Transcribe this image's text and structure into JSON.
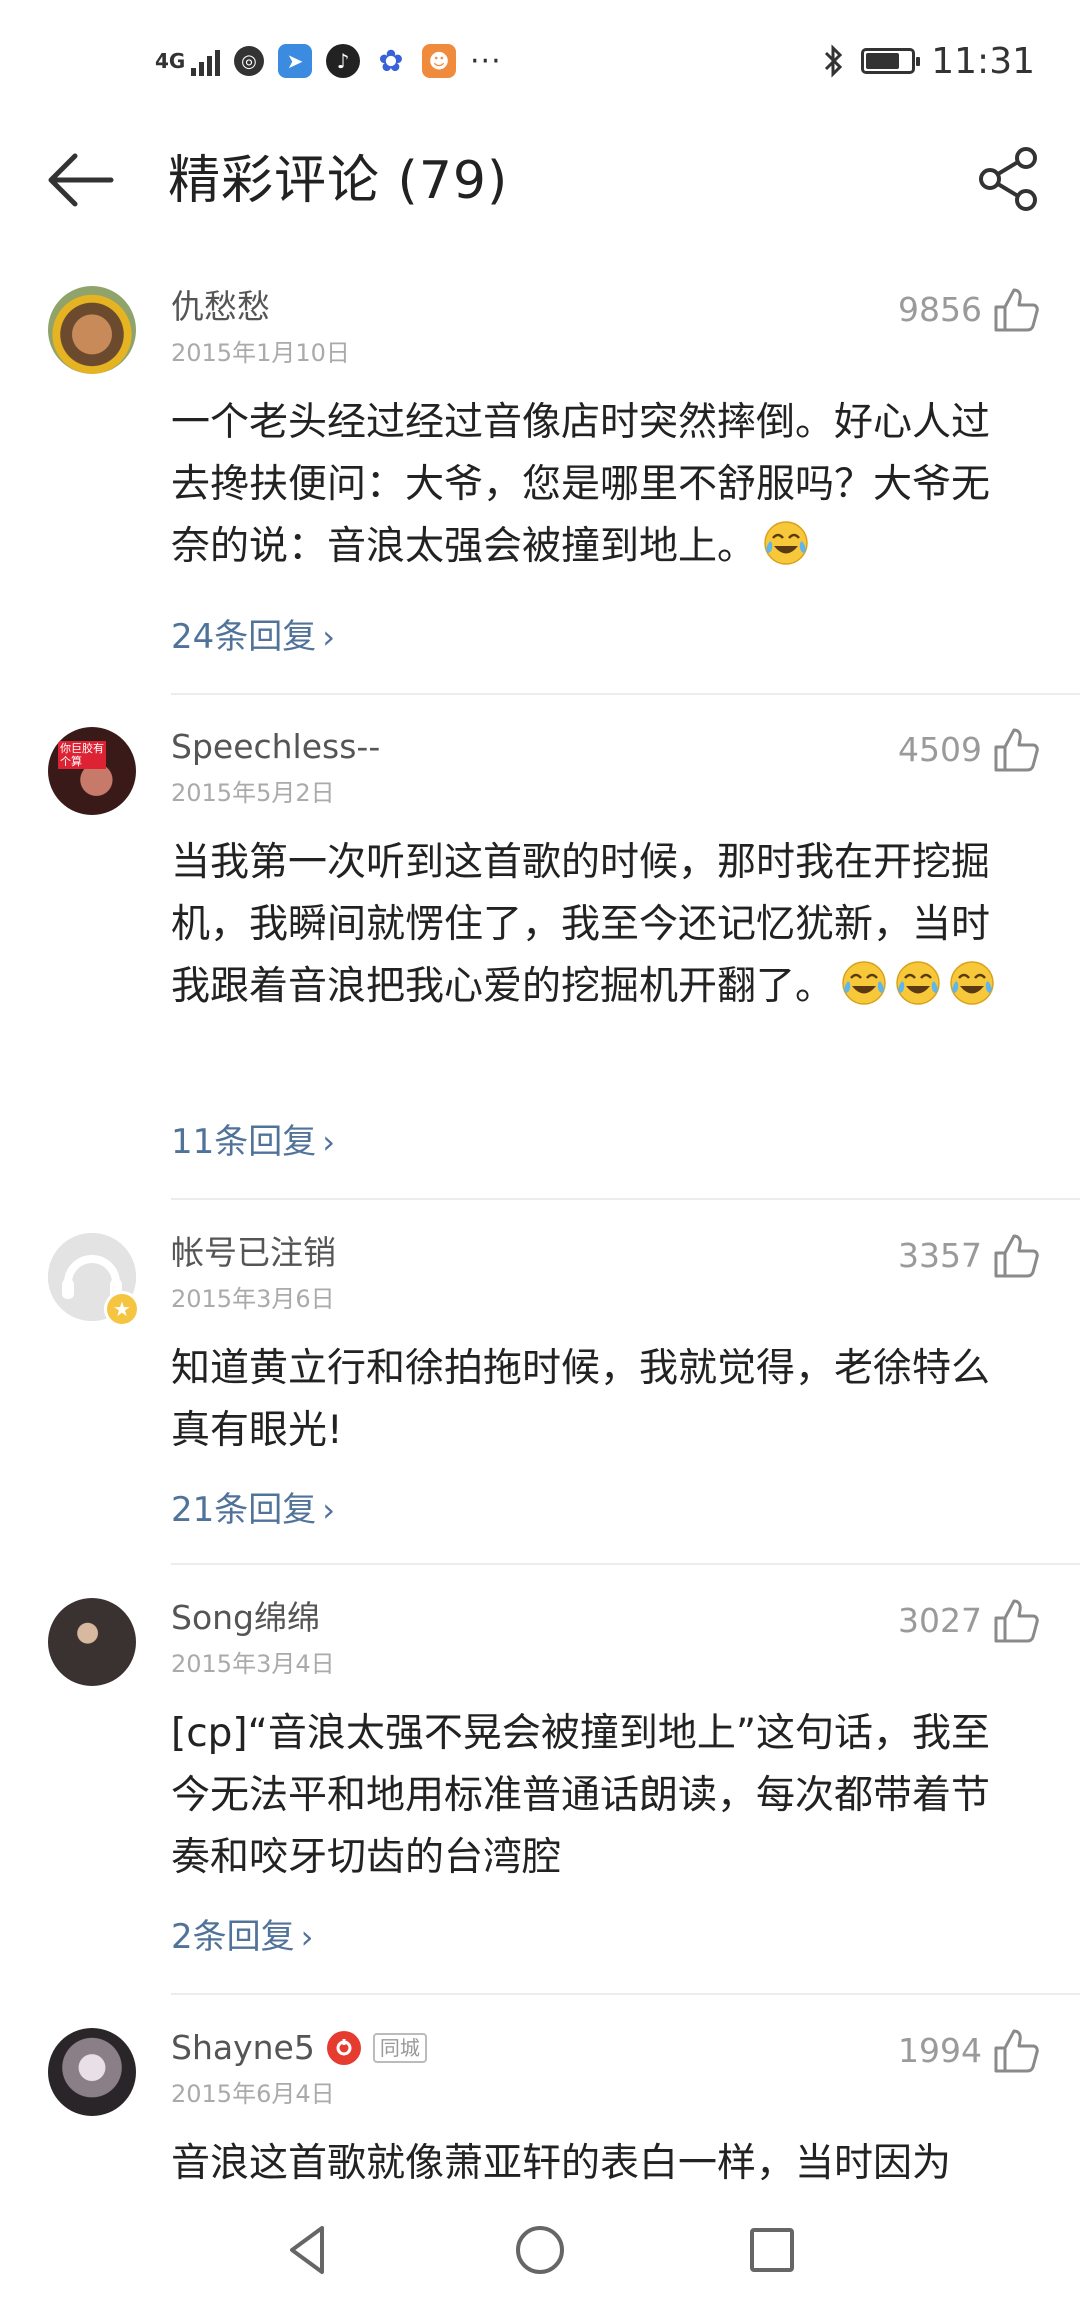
{
  "status_bar": {
    "network": "4G",
    "time": "11:31",
    "more": "···",
    "battery_level": 0.75
  },
  "header": {
    "title": "精彩评论 (79)"
  },
  "comments": [
    {
      "username": "仇愁愁",
      "date": "2015年1月10日",
      "likes": "9856",
      "text": "一个老头经过经过音像店时突然摔倒。好心人过去搀扶便问：大爷，您是哪里不舒服吗？大爷无奈的说：音浪太强会被撞到地上。",
      "emoji_count": 1,
      "replies": "24条回复"
    },
    {
      "username": "Speechless--",
      "date": "2015年5月2日",
      "likes": "4509",
      "text": "当我第一次听到这首歌的时候，那时我在开挖掘机，我瞬间就愣住了，我至今还记忆犹新，当时我跟着音浪把我心爱的挖掘机开翻了。",
      "emoji_count": 3,
      "replies": "11条回复",
      "avatar_text": "你巨胶有个算"
    },
    {
      "username": "帐号已注销",
      "date": "2015年3月6日",
      "likes": "3357",
      "text": "知道黄立行和徐拍拖时候，我就觉得，老徐特么真有眼光!",
      "emoji_count": 0,
      "replies": "21条回复"
    },
    {
      "username": "Song绵绵",
      "date": "2015年3月4日",
      "likes": "3027",
      "text": "[cp]“音浪太强不晃会被撞到地上”这句话，我至今无法平和地用标准普通话朗读，每次都带着节奏和咬牙切齿的台湾腔",
      "emoji_count": 0,
      "replies": "2条回复"
    },
    {
      "username": "Shayne5",
      "city_tag": "同城",
      "date": "2015年6月4日",
      "likes": "1994",
      "text": "音浪这首歌就像萧亚轩的表白一样，当时因为",
      "emoji_count": 0
    }
  ]
}
